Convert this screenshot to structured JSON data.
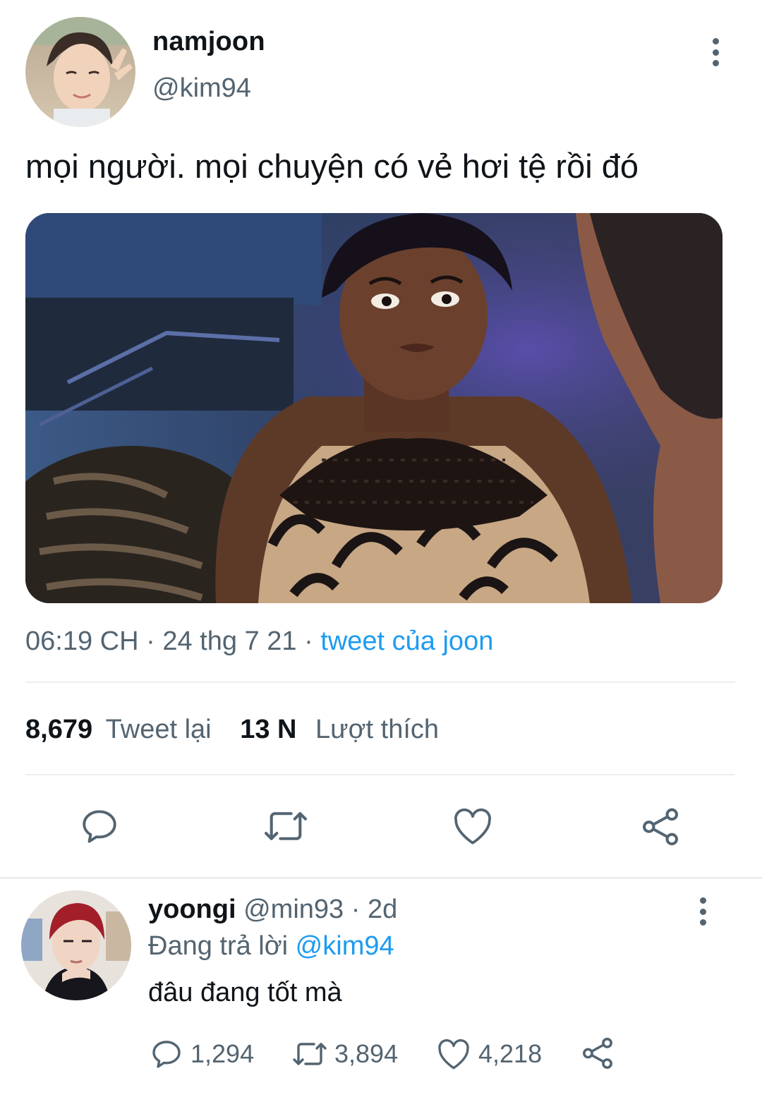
{
  "tweet": {
    "author_name": "namjoon",
    "author_handle": "@kim94",
    "text": "mọi người. mọi chuyện có vẻ hơi tệ rồi đó",
    "time": "06:19 CH",
    "sep1": "·",
    "date": "24 thg 7 21",
    "sep2": "·",
    "source": "tweet của joon",
    "retweet_count": "8,679",
    "retweet_label": "Tweet lại",
    "like_count": "13 N",
    "like_label": "Lượt thích"
  },
  "reply": {
    "author_name": "yoongi",
    "author_handle": "@min93",
    "sep": "·",
    "age": "2d",
    "replying_prefix": "Đang trả lời",
    "replying_to": "@kim94",
    "text": "đâu đang tốt mà",
    "reply_count": "1,294",
    "retweet_count": "3,894",
    "like_count": "4,218"
  },
  "icons": {
    "reply": "speech-bubble-icon",
    "retweet": "retweet-arrows-icon",
    "like": "heart-icon",
    "share": "share-icon",
    "more": "kebab-menu-icon"
  },
  "colors": {
    "link": "#1d9bf0",
    "muted": "#536471",
    "text": "#0f1419",
    "divider": "#eceff1"
  }
}
